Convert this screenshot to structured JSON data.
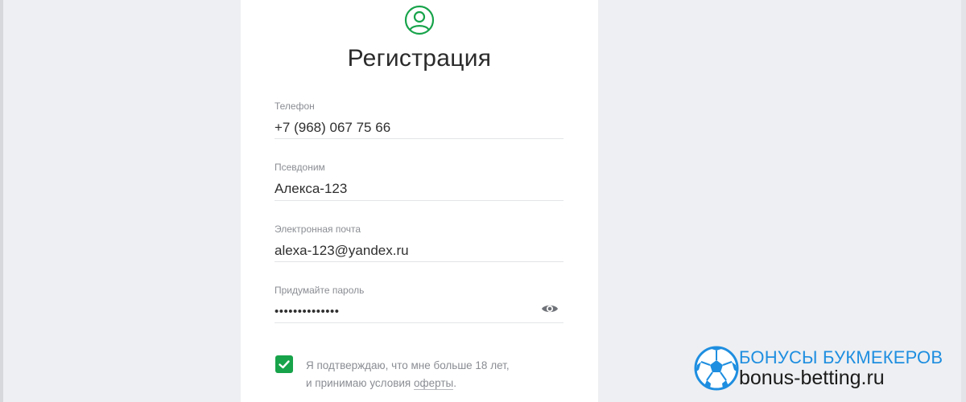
{
  "form": {
    "title": "Регистрация",
    "fields": [
      {
        "label": "Телефон",
        "value": "+7 (968) 067 75 66"
      },
      {
        "label": "Псевдоним",
        "value": "Алекса-123"
      },
      {
        "label": "Электронная почта",
        "value": "alexa-123@yandex.ru"
      },
      {
        "label": "Придумайте пароль",
        "value": "••••••••••••••"
      }
    ],
    "consent": {
      "checked": true,
      "line1": "Я подтверждаю, что мне больше 18 лет,",
      "line2_prefix": "и принимаю условия ",
      "link_text": "оферты",
      "line2_suffix": "."
    }
  },
  "icons": {
    "avatar": "user-circle-icon",
    "password_toggle": "eye-icon",
    "checkbox": "checkmark-icon"
  },
  "colors": {
    "accent": "#17a34a",
    "background": "#eeeff2",
    "watermark_blue": "#1e8ee0"
  },
  "watermark": {
    "line1": "БОНУСЫ БУКМЕКЕРОВ",
    "line2": "bonus-betting.ru"
  }
}
